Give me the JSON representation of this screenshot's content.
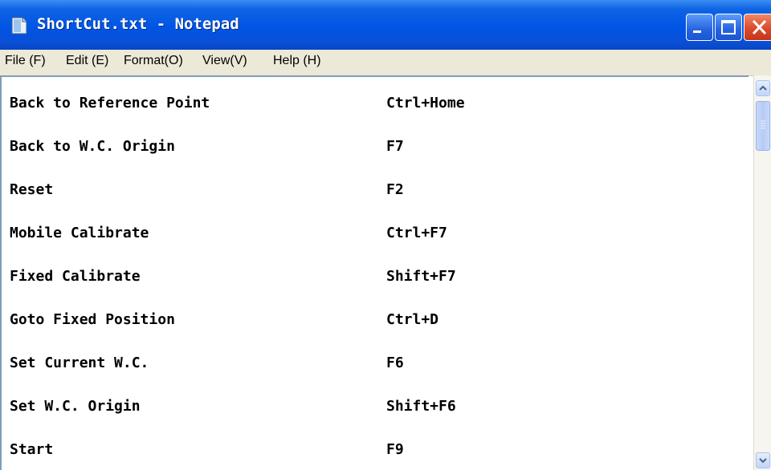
{
  "window": {
    "title": "ShortCut.txt - Notepad",
    "colors": {
      "titlebar": "#0055e5",
      "close_button": "#db4a2a",
      "menubar": "#ece9d8"
    }
  },
  "menu": {
    "file": "File (F)",
    "edit": "Edit (E)",
    "format": "Format(O)",
    "view": "View(V)",
    "help": "Help (H)"
  },
  "shortcuts": [
    {
      "action": "Back to Reference Point",
      "key": "Ctrl+Home"
    },
    {
      "action": "Back to W.C. Origin",
      "key": "F7"
    },
    {
      "action": "Reset",
      "key": "F2"
    },
    {
      "action": "Mobile Calibrate",
      "key": "Ctrl+F7"
    },
    {
      "action": "Fixed Calibrate",
      "key": "Shift+F7"
    },
    {
      "action": "Goto Fixed Position",
      "key": "Ctrl+D"
    },
    {
      "action": "Set Current W.C.",
      "key": "F6"
    },
    {
      "action": "Set W.C. Origin",
      "key": "Shift+F6"
    },
    {
      "action": "Start",
      "key": "F9"
    }
  ],
  "icons": {
    "app": "notepad-icon",
    "minimize": "minimize-icon",
    "maximize": "maximize-icon",
    "close": "close-icon",
    "scroll_up": "scroll-up-arrow-icon",
    "scroll_down": "scroll-down-arrow-icon"
  }
}
